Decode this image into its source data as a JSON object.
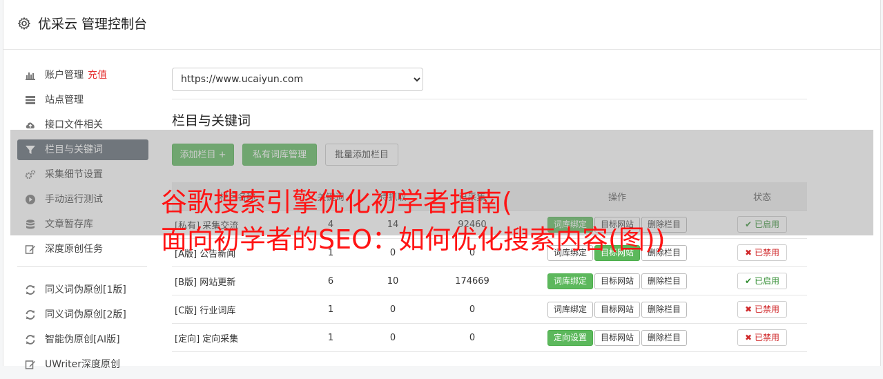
{
  "header": {
    "title": "优采云 管理控制台",
    "icon": "gear-icon"
  },
  "sidebar": {
    "items": [
      {
        "label": "账户管理",
        "extra": "充值",
        "icon": "bar-chart-icon"
      },
      {
        "label": "站点管理",
        "icon": "server-icon"
      },
      {
        "label": "接口文件相关",
        "icon": "cloud-upload-icon"
      },
      {
        "label": "栏目与关键词",
        "icon": "filter-icon",
        "active": true
      },
      {
        "label": "采集细节设置",
        "icon": "gears-icon"
      },
      {
        "label": "手动运行测试",
        "icon": "play-circle-icon"
      },
      {
        "label": "文章暂存库",
        "icon": "database-icon"
      },
      {
        "label": "深度原创任务",
        "icon": "edit-icon"
      }
    ],
    "items2": [
      {
        "label": "同义词伪原创[1版]",
        "icon": "refresh-icon"
      },
      {
        "label": "同义词伪原创[2版]",
        "icon": "refresh-icon"
      },
      {
        "label": "智能伪原创[AI版]",
        "icon": "refresh-icon"
      },
      {
        "label": "UWriter深度原创",
        "icon": "edit-icon"
      }
    ]
  },
  "main": {
    "site_select": {
      "value": "https://www.ucaiyun.com",
      "options": [
        "https://www.ucaiyun.com"
      ]
    },
    "section_title": "栏目与关键词",
    "buttons": {
      "add": "添加栏目 +",
      "private_lib": "私有词库管理",
      "batch_add": "批量添加栏目"
    },
    "table": {
      "headers": [
        "栏目名称",
        "关键词",
        "待抓取",
        "已采集",
        "操作",
        "状态"
      ],
      "rows": [
        {
          "tag": "[私有]",
          "name": "采集交流",
          "tag_color": "green",
          "kw": "4",
          "pending": "14",
          "collected": "92460",
          "op1": "词库绑定",
          "op1_style": "g",
          "op2": "目标网站",
          "op2_style": "d",
          "op3": "删除栏目",
          "status": "已启用",
          "status_on": true
        },
        {
          "tag": "[A版]",
          "name": "公告新闻",
          "tag_color": "red",
          "kw": "1",
          "pending": "0",
          "collected": "0",
          "op1": "词库绑定",
          "op1_style": "d",
          "op2": "目标网站",
          "op2_style": "g",
          "op3": "删除栏目",
          "status": "已禁用",
          "status_on": false
        },
        {
          "tag": "[B版]",
          "name": "网站更新",
          "tag_color": "blue",
          "kw": "6",
          "pending": "10",
          "collected": "174669",
          "op1": "词库绑定",
          "op1_style": "g",
          "op2": "目标网站",
          "op2_style": "d",
          "op3": "删除栏目",
          "status": "已启用",
          "status_on": true
        },
        {
          "tag": "[C版]",
          "name": "行业词库",
          "tag_color": "red",
          "kw": "1",
          "pending": "0",
          "collected": "0",
          "op1": "词库绑定",
          "op1_style": "d",
          "op2": "目标网站",
          "op2_style": "d",
          "op3": "删除栏目",
          "status": "已禁用",
          "status_on": false
        },
        {
          "tag": "[定向]",
          "name": "定向采集",
          "tag_color": "purple",
          "kw": "1",
          "pending": "0",
          "collected": "0",
          "op1": "定向设置",
          "op1_style": "g",
          "op2": "目标网站",
          "op2_style": "d",
          "op3": "删除栏目",
          "status": "已禁用",
          "status_on": false
        }
      ]
    }
  },
  "overlay": {
    "line1": "谷歌搜索引擎优化初学者指南(",
    "line2": "面向初学者的SEO：如何优化搜索内容(图))"
  },
  "colors": {
    "accent_green": "#5cb85c",
    "active_nav": "#5c6770",
    "overlay_text": "#ff1414"
  }
}
